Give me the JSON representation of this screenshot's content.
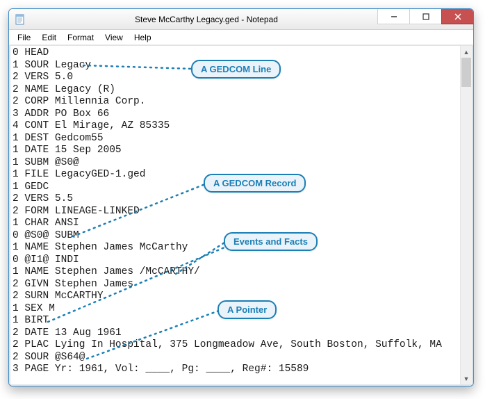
{
  "window": {
    "title": "Steve McCarthy Legacy.ged - Notepad"
  },
  "menubar": {
    "items": [
      "File",
      "Edit",
      "Format",
      "View",
      "Help"
    ]
  },
  "content": {
    "lines": [
      "0 HEAD",
      "1 SOUR Legacy",
      "2 VERS 5.0",
      "2 NAME Legacy (R)",
      "2 CORP Millennia Corp.",
      "3 ADDR PO Box 66",
      "4 CONT El Mirage, AZ 85335",
      "1 DEST Gedcom55",
      "1 DATE 15 Sep 2005",
      "1 SUBM @S0@",
      "1 FILE LegacyGED-1.ged",
      "1 GEDC",
      "2 VERS 5.5",
      "2 FORM LINEAGE-LINKED",
      "1 CHAR ANSI",
      "0 @S0@ SUBM",
      "1 NAME Stephen James McCarthy",
      "0 @I1@ INDI",
      "1 NAME Stephen James /McCARTHY/",
      "2 GIVN Stephen James",
      "2 SURN McCARTHY",
      "1 SEX M",
      "1 BIRT",
      "2 DATE 13 Aug 1961",
      "2 PLAC Lying In Hospital, 375 Longmeadow Ave, South Boston, Suffolk, MA",
      "2 SOUR @S64@",
      "3 PAGE Yr: 1961, Vol: ____, Pg: ____, Reg#: 15589"
    ]
  },
  "annotations": {
    "gedcom_line": "A GEDCOM Line",
    "gedcom_record": "A GEDCOM Record",
    "events_facts": "Events and Facts",
    "pointer": "A Pointer"
  },
  "colors": {
    "accent": "#1b7fb5",
    "close_btn": "#c75050"
  }
}
